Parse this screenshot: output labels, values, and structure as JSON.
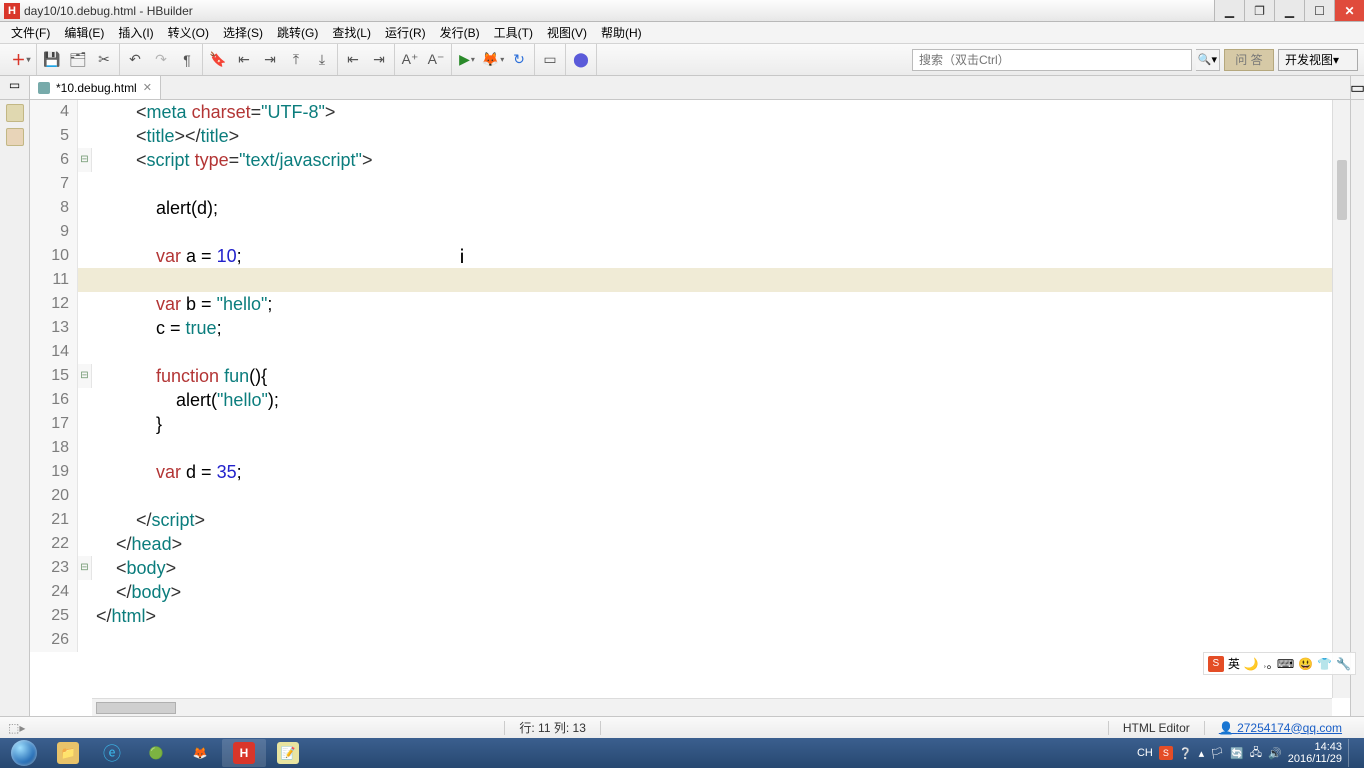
{
  "title": "day10/10.debug.html  -  HBuilder",
  "menu": [
    "文件(F)",
    "编辑(E)",
    "插入(I)",
    "转义(O)",
    "选择(S)",
    "跳转(G)",
    "查找(L)",
    "运行(R)",
    "发行(B)",
    "工具(T)",
    "视图(V)",
    "帮助(H)"
  ],
  "tab": {
    "label": "*10.debug.html"
  },
  "search": {
    "placeholder": "搜索（双击Ctrl）"
  },
  "ask_label": "问 答",
  "view_label": "开发视图",
  "status": {
    "pos": "行: 11 列: 13",
    "editor": "HTML Editor",
    "user": "27254174@qq.com"
  },
  "clock": {
    "time": "14:43",
    "date": "2016/11/29"
  },
  "tray": {
    "lang": "CH",
    "ime": "英"
  },
  "lines": [
    {
      "n": 4,
      "fold": "",
      "html": "        <span class='c-op'>&lt;</span><span class='c-tag'>meta</span> <span class='c-attr'>charset</span><span class='c-op'>=</span><span class='c-str'>\"UTF-8\"</span><span class='c-op'>&gt;</span>"
    },
    {
      "n": 5,
      "fold": "",
      "html": "        <span class='c-op'>&lt;</span><span class='c-tag'>title</span><span class='c-op'>&gt;&lt;/</span><span class='c-tag'>title</span><span class='c-op'>&gt;</span>"
    },
    {
      "n": 6,
      "fold": "⊟",
      "html": "        <span class='c-op'>&lt;</span><span class='c-tag'>script</span> <span class='c-attr'>type</span><span class='c-op'>=</span><span class='c-str'>\"text/javascript\"</span><span class='c-op'>&gt;</span>"
    },
    {
      "n": 7,
      "fold": "",
      "html": ""
    },
    {
      "n": 8,
      "fold": "",
      "html": "            alert(d);"
    },
    {
      "n": 9,
      "fold": "",
      "html": ""
    },
    {
      "n": 10,
      "fold": "",
      "html": "            <span class='c-kw'>var</span> a = <span class='c-num'>10</span>;"
    },
    {
      "n": 11,
      "fold": "",
      "current": true,
      "html": ""
    },
    {
      "n": 12,
      "fold": "",
      "html": "            <span class='c-kw'>var</span> b = <span class='c-str'>\"hello\"</span>;"
    },
    {
      "n": 13,
      "fold": "",
      "html": "            c = <span class='c-val'>true</span>;"
    },
    {
      "n": 14,
      "fold": "",
      "html": ""
    },
    {
      "n": 15,
      "fold": "⊟",
      "html": "            <span class='c-kw'>function</span> <span class='c-fn'>fun</span>(){"
    },
    {
      "n": 16,
      "fold": "",
      "html": "                alert(<span class='c-str'>\"hello\"</span>);"
    },
    {
      "n": 17,
      "fold": "",
      "html": "            }"
    },
    {
      "n": 18,
      "fold": "",
      "html": ""
    },
    {
      "n": 19,
      "fold": "",
      "html": "            <span class='c-kw'>var</span> d = <span class='c-num'>35</span>;"
    },
    {
      "n": 20,
      "fold": "",
      "html": ""
    },
    {
      "n": 21,
      "fold": "",
      "html": "        <span class='c-op'>&lt;/</span><span class='c-tag'>script</span><span class='c-op'>&gt;</span>"
    },
    {
      "n": 22,
      "fold": "",
      "html": "    <span class='c-op'>&lt;/</span><span class='c-tag'>head</span><span class='c-op'>&gt;</span>"
    },
    {
      "n": 23,
      "fold": "⊟",
      "html": "    <span class='c-op'>&lt;</span><span class='c-tag'>body</span><span class='c-op'>&gt;</span>"
    },
    {
      "n": 24,
      "fold": "",
      "html": "    <span class='c-op'>&lt;/</span><span class='c-tag'>body</span><span class='c-op'>&gt;</span>"
    },
    {
      "n": 25,
      "fold": "",
      "html": "<span class='c-op'>&lt;/</span><span class='c-tag'>html</span><span class='c-op'>&gt;</span>"
    },
    {
      "n": 26,
      "fold": "",
      "html": ""
    }
  ]
}
